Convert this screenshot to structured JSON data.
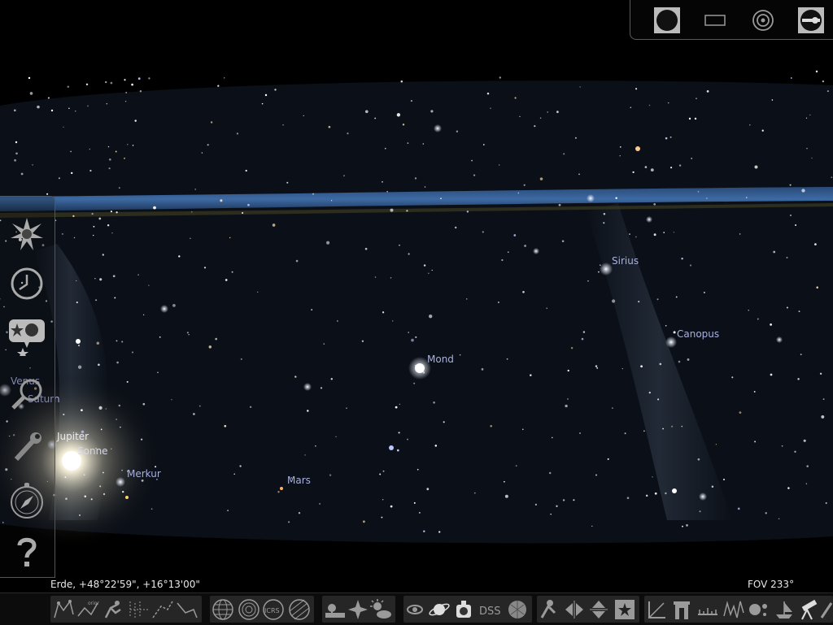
{
  "sky": {
    "objects": [
      {
        "name": "Sirius",
        "kind": "star"
      },
      {
        "name": "Canopus",
        "kind": "star"
      },
      {
        "name": "Mond",
        "kind": "moon"
      },
      {
        "name": "Mars",
        "kind": "planet"
      },
      {
        "name": "Merkur",
        "kind": "planet"
      },
      {
        "name": "Sonne",
        "kind": "sun"
      },
      {
        "name": "Jupiter",
        "kind": "planet"
      },
      {
        "name": "Saturn",
        "kind": "planet"
      },
      {
        "name": "Venus",
        "kind": "planet"
      }
    ]
  },
  "status": {
    "location": "Erde, +48°22'59\", +16°13'00\"",
    "fov": "FOV 233°"
  },
  "top_panel": {
    "buttons": [
      "full-circle-icon",
      "rectangle-icon",
      "target-icon",
      "wrench-circle-icon"
    ]
  },
  "left_panel": {
    "buttons": [
      "location-star-icon",
      "clock-icon",
      "sky-viewing-icon",
      "search-icon",
      "settings-wrench-icon",
      "compass-icon",
      "help-icon"
    ]
  },
  "bottom_bar": {
    "dss_label": "DSS",
    "orion_label": "orion",
    "icrs_label": "ICRS"
  }
}
